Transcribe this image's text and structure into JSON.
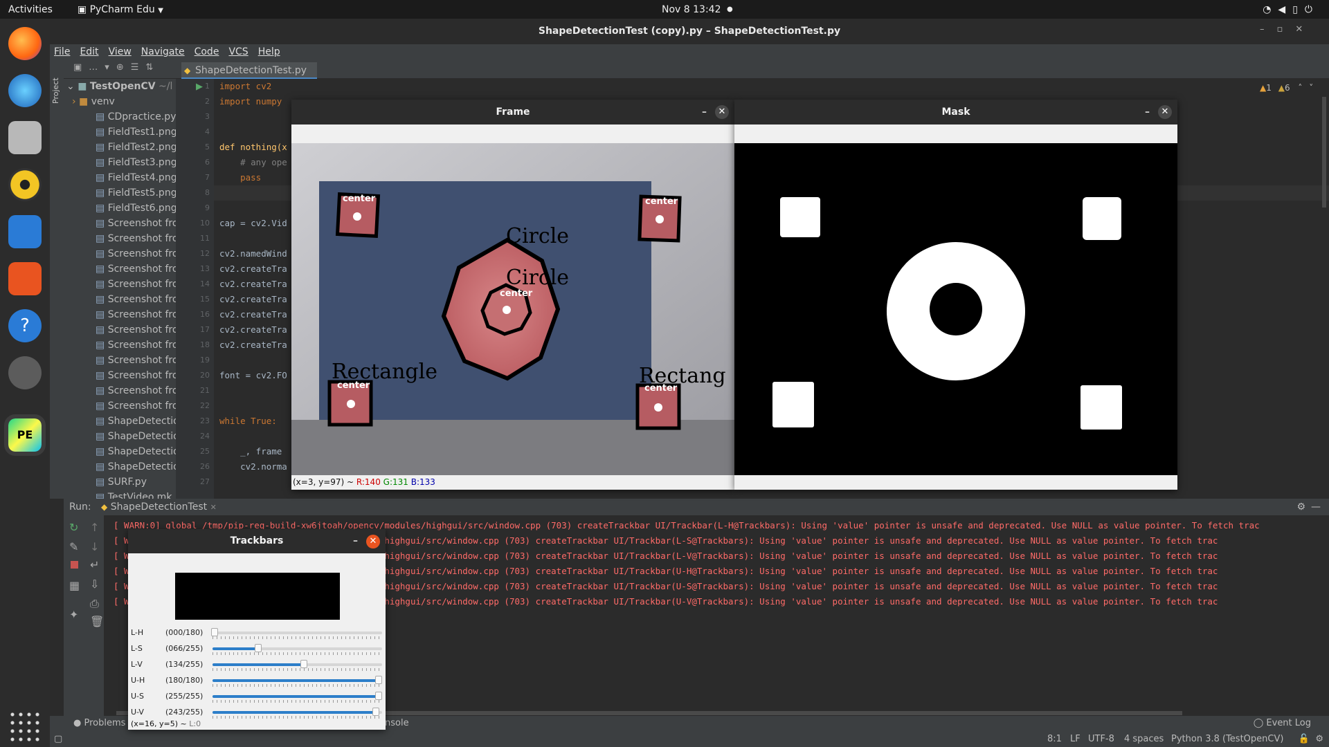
{
  "topbar": {
    "activities": "Activities",
    "app": "PyCharm Edu",
    "datetime": "Nov 8  13:42"
  },
  "window_title": "ShapeDetectionTest (copy).py – ShapeDetectionTest.py",
  "menu": [
    "File",
    "Edit",
    "View",
    "Navigate",
    "Code",
    "VCS",
    "Help"
  ],
  "sidebar_label": "Project",
  "editor_tab": "ShapeDetectionTest.py",
  "warnings": {
    "errors": "1",
    "warns": "6"
  },
  "project": {
    "root": "TestOpenCV",
    "root_path": "~/l",
    "items": [
      "venv",
      "CDpractice.py",
      "FieldTest1.png",
      "FieldTest2.png",
      "FieldTest3.png",
      "FieldTest4.png",
      "FieldTest5.png",
      "FieldTest6.png",
      "Screenshot fro",
      "Screenshot fro",
      "Screenshot fro",
      "Screenshot fro",
      "Screenshot fro",
      "Screenshot fro",
      "Screenshot fro",
      "Screenshot fro",
      "Screenshot fro",
      "Screenshot fro",
      "Screenshot fro",
      "Screenshot fro",
      "Screenshot fro",
      "ShapeDetectio",
      "ShapeDetectio",
      "ShapeDetectio",
      "ShapeDetectio",
      "SURF.py",
      "TestVideo.mk"
    ]
  },
  "code_lines": [
    "1",
    "2",
    "3",
    "4",
    "5",
    "6",
    "7",
    "8",
    "9",
    "10",
    "11",
    "12",
    "13",
    "14",
    "15",
    "16",
    "17",
    "18",
    "19",
    "20",
    "21",
    "22",
    "23",
    "24",
    "25",
    "26",
    "27"
  ],
  "code": {
    "l1": "import cv2",
    "l2": "import numpy",
    "l5": "def nothing(x",
    "l6": "    # any ope",
    "l7": "    pass",
    "l10": "cap = cv2.Vid",
    "l12": "cv2.namedWind",
    "l13": "cv2.createTra",
    "l14": "cv2.createTra",
    "l15": "cv2.createTra",
    "l16": "cv2.createTra",
    "l17": "cv2.createTra",
    "l18": "cv2.createTra",
    "l20": "font = cv2.FO",
    "l23": "while True:",
    "l25": "    _, frame",
    "l26": "    cv2.norma"
  },
  "frame_window": {
    "title": "Frame",
    "labels": {
      "circle1": "Circle",
      "circle2": "Circle",
      "rect1": "Rectangle",
      "rect2": "Rectang"
    },
    "center": "center",
    "status": {
      "coords": "(x=3, y=97) ~ ",
      "r": "R:140",
      "g": "G:131",
      "b": "B:133"
    }
  },
  "mask_window": {
    "title": "Mask"
  },
  "run": {
    "label": "Run:",
    "tab": "ShapeDetectionTest"
  },
  "console_lines": [
    "[ WARN:0] global /tmp/pip-req-build-xw6jtoah/opencv/modules/highgui/src/window.cpp (703) createTrackbar UI/Trackbar(L-H@Trackbars): Using 'value' pointer is unsafe and deprecated. Use NULL as value pointer. To fetch trac",
    "[ W                                      cv/modules/highgui/src/window.cpp (703) createTrackbar UI/Trackbar(L-S@Trackbars): Using 'value' pointer is unsafe and deprecated. Use NULL as value pointer. To fetch trac",
    "[ W                                      cv/modules/highgui/src/window.cpp (703) createTrackbar UI/Trackbar(L-V@Trackbars): Using 'value' pointer is unsafe and deprecated. Use NULL as value pointer. To fetch trac",
    "[ W                                      cv/modules/highgui/src/window.cpp (703) createTrackbar UI/Trackbar(U-H@Trackbars): Using 'value' pointer is unsafe and deprecated. Use NULL as value pointer. To fetch trac",
    "[ W                                      cv/modules/highgui/src/window.cpp (703) createTrackbar UI/Trackbar(U-S@Trackbars): Using 'value' pointer is unsafe and deprecated. Use NULL as value pointer. To fetch trac",
    "[ W                                      cv/modules/highgui/src/window.cpp (703) createTrackbar UI/Trackbar(U-V@Trackbars): Using 'value' pointer is unsafe and deprecated. Use NULL as value pointer. To fetch trac"
  ],
  "trackbars": {
    "title": "Trackbars",
    "rows": [
      {
        "label": "L-H",
        "value": "(000/180)",
        "fraction": 0.0
      },
      {
        "label": "L-S",
        "value": "(066/255)",
        "fraction": 0.259
      },
      {
        "label": "L-V",
        "value": "(134/255)",
        "fraction": 0.525
      },
      {
        "label": "U-H",
        "value": "(180/180)",
        "fraction": 1.0
      },
      {
        "label": "U-S",
        "value": "(255/255)",
        "fraction": 1.0
      },
      {
        "label": "U-V",
        "value": "(243/255)",
        "fraction": 0.953
      }
    ],
    "status": "(x=16, y=5) ~ ",
    "status_l": "L:0"
  },
  "bottom_tabs": {
    "problems": "Problems",
    "console_fragment": "nsole",
    "event_log": "Event Log"
  },
  "statusbar": {
    "pos": "8:1",
    "lf": "LF",
    "enc": "UTF-8",
    "indent": "4 spaces",
    "interp": "Python 3.8 (TestOpenCV)"
  },
  "colors": {
    "accent": "#4a88c7",
    "error_text": "#ff6b68",
    "shape_outline": "#000000",
    "shape_fill": "#c46b6f"
  }
}
